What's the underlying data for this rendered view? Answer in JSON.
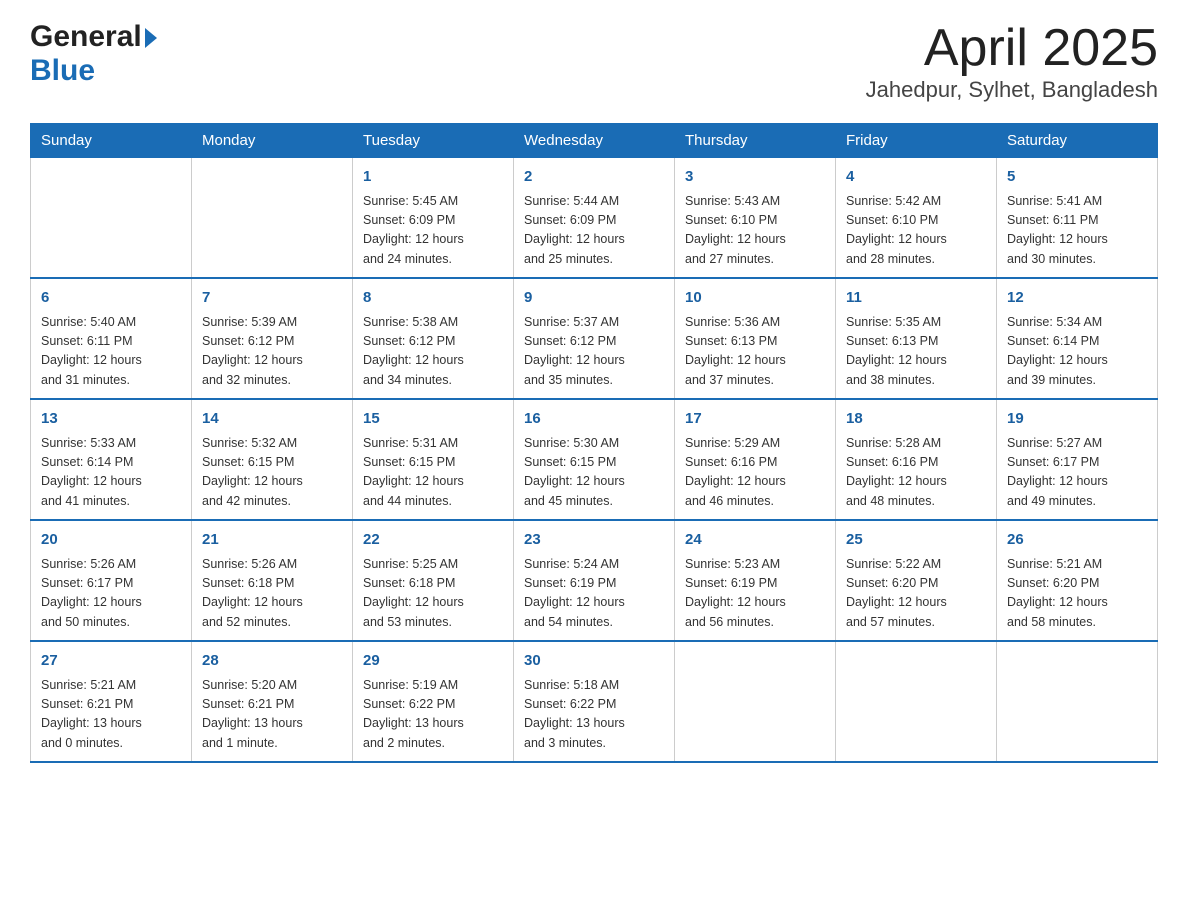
{
  "header": {
    "logo_general": "General",
    "logo_blue": "Blue",
    "month_year": "April 2025",
    "location": "Jahedpur, Sylhet, Bangladesh"
  },
  "weekdays": [
    "Sunday",
    "Monday",
    "Tuesday",
    "Wednesday",
    "Thursday",
    "Friday",
    "Saturday"
  ],
  "weeks": [
    [
      {
        "day": "",
        "info": ""
      },
      {
        "day": "",
        "info": ""
      },
      {
        "day": "1",
        "info": "Sunrise: 5:45 AM\nSunset: 6:09 PM\nDaylight: 12 hours\nand 24 minutes."
      },
      {
        "day": "2",
        "info": "Sunrise: 5:44 AM\nSunset: 6:09 PM\nDaylight: 12 hours\nand 25 minutes."
      },
      {
        "day": "3",
        "info": "Sunrise: 5:43 AM\nSunset: 6:10 PM\nDaylight: 12 hours\nand 27 minutes."
      },
      {
        "day": "4",
        "info": "Sunrise: 5:42 AM\nSunset: 6:10 PM\nDaylight: 12 hours\nand 28 minutes."
      },
      {
        "day": "5",
        "info": "Sunrise: 5:41 AM\nSunset: 6:11 PM\nDaylight: 12 hours\nand 30 minutes."
      }
    ],
    [
      {
        "day": "6",
        "info": "Sunrise: 5:40 AM\nSunset: 6:11 PM\nDaylight: 12 hours\nand 31 minutes."
      },
      {
        "day": "7",
        "info": "Sunrise: 5:39 AM\nSunset: 6:12 PM\nDaylight: 12 hours\nand 32 minutes."
      },
      {
        "day": "8",
        "info": "Sunrise: 5:38 AM\nSunset: 6:12 PM\nDaylight: 12 hours\nand 34 minutes."
      },
      {
        "day": "9",
        "info": "Sunrise: 5:37 AM\nSunset: 6:12 PM\nDaylight: 12 hours\nand 35 minutes."
      },
      {
        "day": "10",
        "info": "Sunrise: 5:36 AM\nSunset: 6:13 PM\nDaylight: 12 hours\nand 37 minutes."
      },
      {
        "day": "11",
        "info": "Sunrise: 5:35 AM\nSunset: 6:13 PM\nDaylight: 12 hours\nand 38 minutes."
      },
      {
        "day": "12",
        "info": "Sunrise: 5:34 AM\nSunset: 6:14 PM\nDaylight: 12 hours\nand 39 minutes."
      }
    ],
    [
      {
        "day": "13",
        "info": "Sunrise: 5:33 AM\nSunset: 6:14 PM\nDaylight: 12 hours\nand 41 minutes."
      },
      {
        "day": "14",
        "info": "Sunrise: 5:32 AM\nSunset: 6:15 PM\nDaylight: 12 hours\nand 42 minutes."
      },
      {
        "day": "15",
        "info": "Sunrise: 5:31 AM\nSunset: 6:15 PM\nDaylight: 12 hours\nand 44 minutes."
      },
      {
        "day": "16",
        "info": "Sunrise: 5:30 AM\nSunset: 6:15 PM\nDaylight: 12 hours\nand 45 minutes."
      },
      {
        "day": "17",
        "info": "Sunrise: 5:29 AM\nSunset: 6:16 PM\nDaylight: 12 hours\nand 46 minutes."
      },
      {
        "day": "18",
        "info": "Sunrise: 5:28 AM\nSunset: 6:16 PM\nDaylight: 12 hours\nand 48 minutes."
      },
      {
        "day": "19",
        "info": "Sunrise: 5:27 AM\nSunset: 6:17 PM\nDaylight: 12 hours\nand 49 minutes."
      }
    ],
    [
      {
        "day": "20",
        "info": "Sunrise: 5:26 AM\nSunset: 6:17 PM\nDaylight: 12 hours\nand 50 minutes."
      },
      {
        "day": "21",
        "info": "Sunrise: 5:26 AM\nSunset: 6:18 PM\nDaylight: 12 hours\nand 52 minutes."
      },
      {
        "day": "22",
        "info": "Sunrise: 5:25 AM\nSunset: 6:18 PM\nDaylight: 12 hours\nand 53 minutes."
      },
      {
        "day": "23",
        "info": "Sunrise: 5:24 AM\nSunset: 6:19 PM\nDaylight: 12 hours\nand 54 minutes."
      },
      {
        "day": "24",
        "info": "Sunrise: 5:23 AM\nSunset: 6:19 PM\nDaylight: 12 hours\nand 56 minutes."
      },
      {
        "day": "25",
        "info": "Sunrise: 5:22 AM\nSunset: 6:20 PM\nDaylight: 12 hours\nand 57 minutes."
      },
      {
        "day": "26",
        "info": "Sunrise: 5:21 AM\nSunset: 6:20 PM\nDaylight: 12 hours\nand 58 minutes."
      }
    ],
    [
      {
        "day": "27",
        "info": "Sunrise: 5:21 AM\nSunset: 6:21 PM\nDaylight: 13 hours\nand 0 minutes."
      },
      {
        "day": "28",
        "info": "Sunrise: 5:20 AM\nSunset: 6:21 PM\nDaylight: 13 hours\nand 1 minute."
      },
      {
        "day": "29",
        "info": "Sunrise: 5:19 AM\nSunset: 6:22 PM\nDaylight: 13 hours\nand 2 minutes."
      },
      {
        "day": "30",
        "info": "Sunrise: 5:18 AM\nSunset: 6:22 PM\nDaylight: 13 hours\nand 3 minutes."
      },
      {
        "day": "",
        "info": ""
      },
      {
        "day": "",
        "info": ""
      },
      {
        "day": "",
        "info": ""
      }
    ]
  ]
}
